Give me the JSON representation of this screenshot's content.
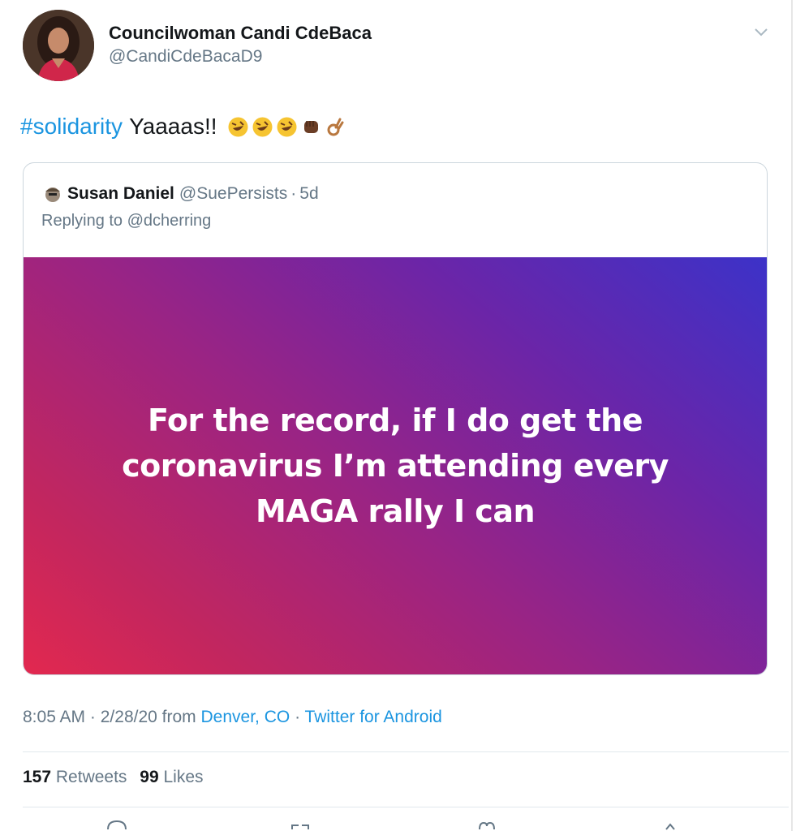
{
  "author": {
    "name": "Councilwoman Candi CdeBaca",
    "handle": "@CandiCdeBacaD9"
  },
  "tweet": {
    "hashtag": "#solidarity",
    "text": "Yaaaas!!",
    "emojis": [
      "rolling-laughing-emoji",
      "rolling-laughing-emoji",
      "rolling-laughing-emoji",
      "raised-fist-emoji",
      "ok-hand-emoji"
    ]
  },
  "quote": {
    "name": "Susan Daniel",
    "handle": "@SuePersists",
    "separator": "·",
    "time": "5d",
    "replying_prefix": "Replying to",
    "replying_to": "@dcherring",
    "image_text": "For the record, if I do get the coronavirus I’m attending every MAGA rally I can"
  },
  "meta": {
    "time": "8:05 AM",
    "separator": "·",
    "date": "2/28/20",
    "from_label": "from",
    "location": "Denver, CO",
    "source": "Twitter for Android"
  },
  "stats": {
    "retweets_count": "157",
    "retweets_label": "Retweets",
    "likes_count": "99",
    "likes_label": "Likes"
  },
  "icons": {
    "menu": "chevron-down-icon",
    "actions": [
      "reply-icon",
      "retweet-icon",
      "like-icon",
      "share-icon"
    ]
  },
  "colors": {
    "link": "#1b95e0",
    "secondary_text": "#657786",
    "gradient_start": "#e2284f",
    "gradient_end": "#3c32c8"
  }
}
